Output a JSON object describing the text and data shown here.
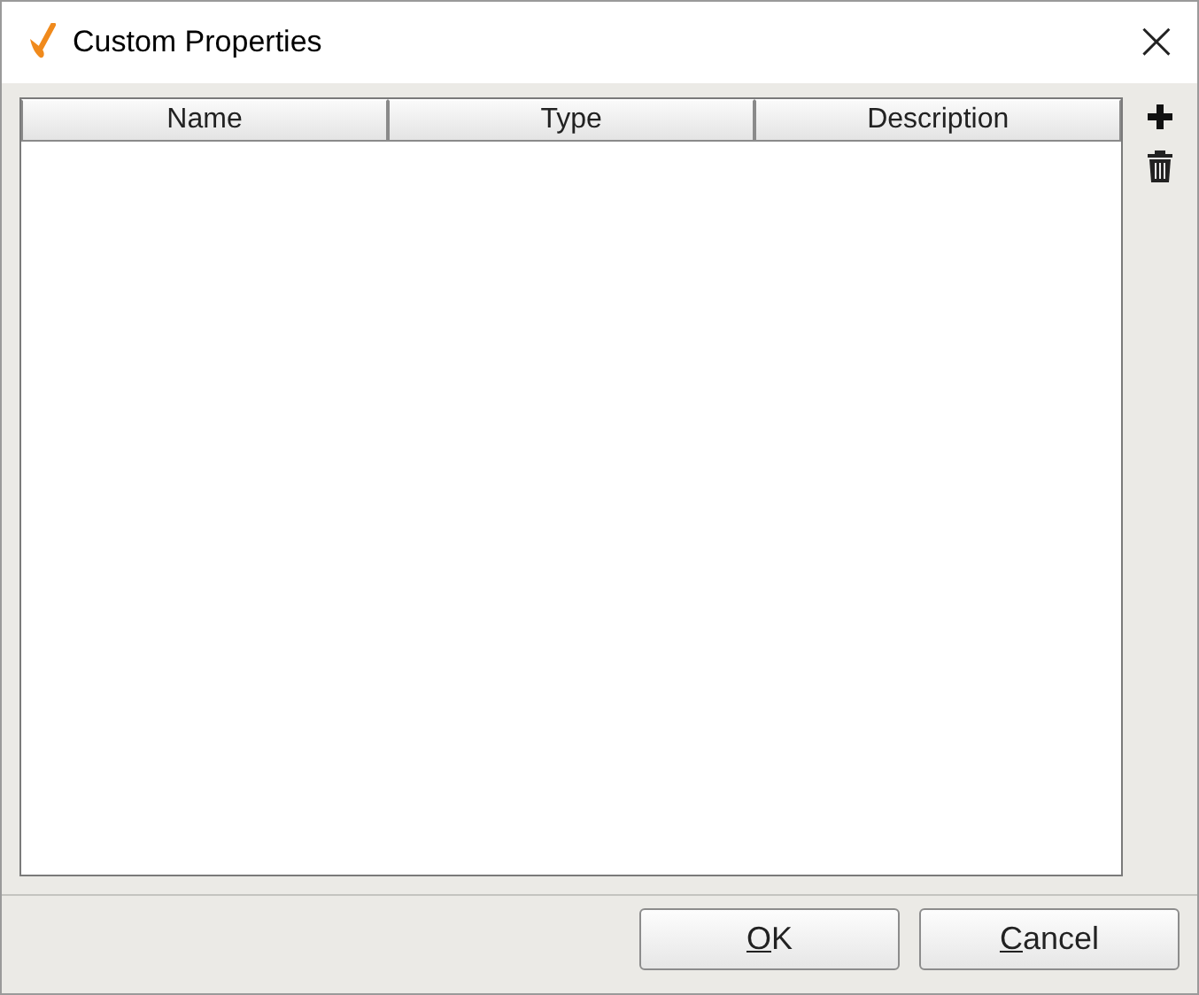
{
  "window": {
    "title": "Custom Properties",
    "close": "×"
  },
  "table": {
    "columns": [
      "Name",
      "Type",
      "Description"
    ]
  },
  "buttons": [
    {
      "mnemonic": "O",
      "rest": "K"
    },
    {
      "mnemonic": "C",
      "rest": "ancel"
    }
  ]
}
